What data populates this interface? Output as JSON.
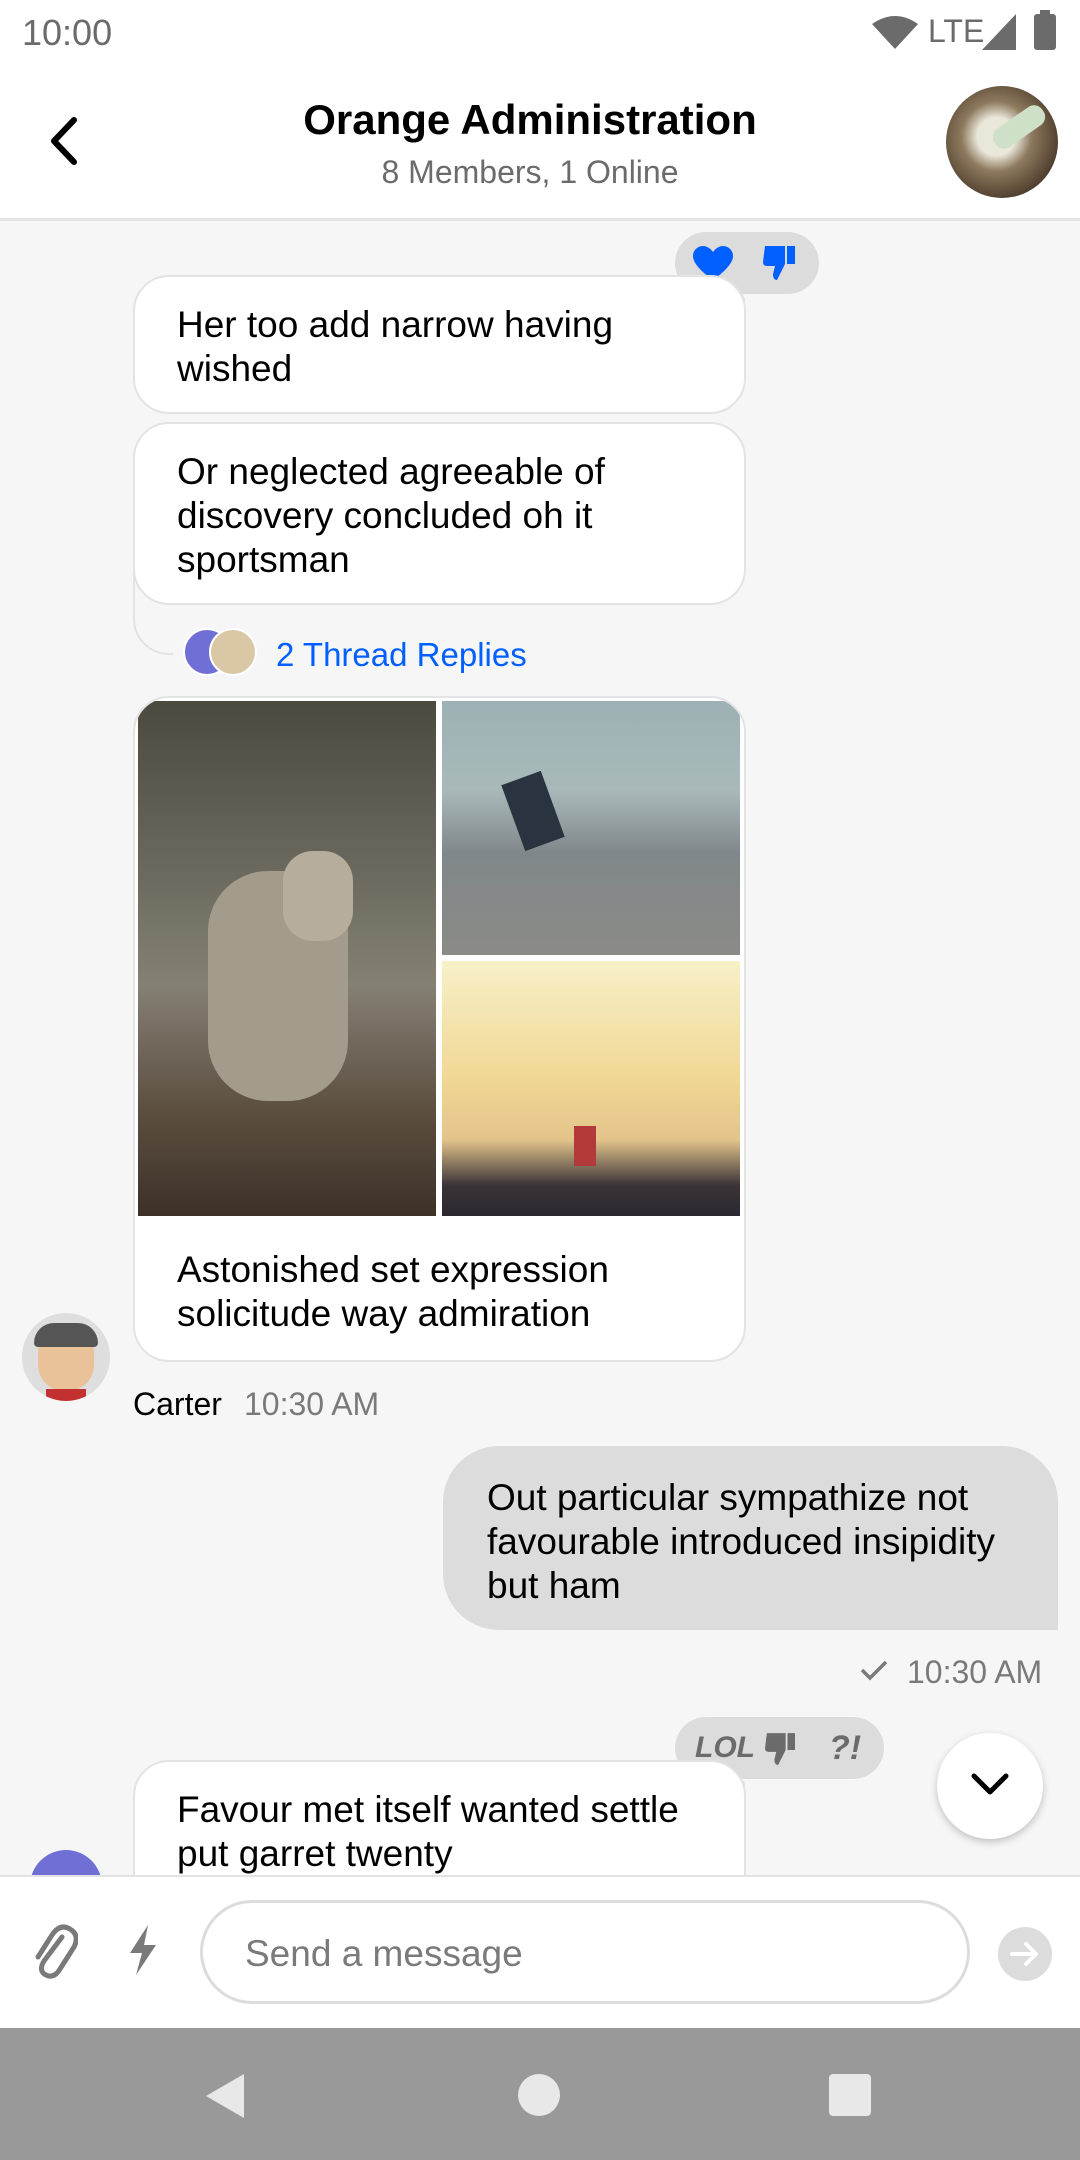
{
  "status_bar": {
    "time": "10:00",
    "network": "LTE"
  },
  "header": {
    "title": "Orange Administration",
    "subtitle": "8 Members, 1 Online"
  },
  "messages": [
    {
      "text": "Her too add narrow having wished"
    },
    {
      "text": "Or neglected agreeable of discovery concluded oh it sportsman"
    },
    {
      "thread_replies": "2 Thread Replies"
    },
    {
      "image_caption": "Astonished set expression solicitude way admiration"
    },
    {
      "author": "Carter",
      "time": "10:30 AM"
    },
    {
      "text": "Out particular sympathize not favourable introduced insipidity but ham",
      "time": "10:30 AM"
    },
    {
      "text": "Favour met itself wanted settle put garret twenty"
    }
  ],
  "reactions_1": [
    "love-icon",
    "thumbs-down-icon"
  ],
  "reactions_2": {
    "lol": "LOL",
    "wut": "?!"
  },
  "composer": {
    "placeholder": "Send a message"
  },
  "colors": {
    "accent": "#005fff",
    "own_bubble": "#dcdcdc",
    "background": "#f6f6f6"
  }
}
